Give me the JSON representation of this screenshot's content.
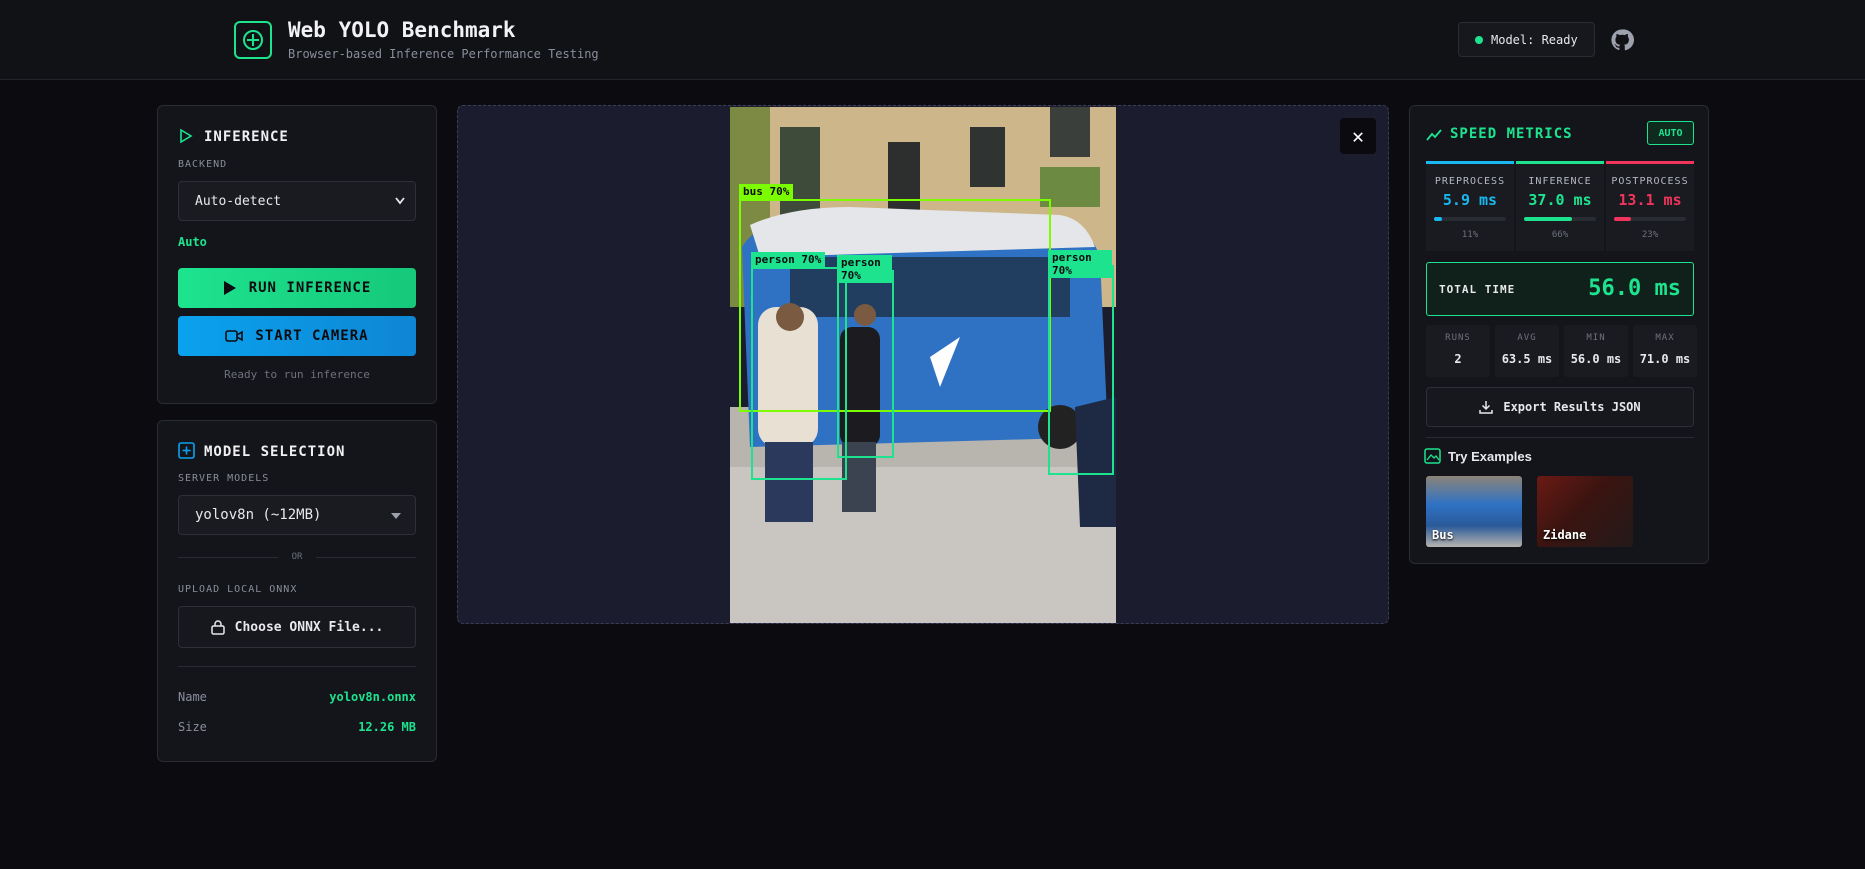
{
  "header": {
    "title": "Web YOLO Benchmark",
    "subtitle": "Browser-based Inference Performance Testing",
    "status": "Model: Ready"
  },
  "inference": {
    "title": "INFERENCE",
    "backend_label": "BACKEND",
    "backend_value": "Auto-detect",
    "backend_detected": "Auto",
    "run_label": "RUN INFERENCE",
    "camera_label": "START CAMERA",
    "status_text": "Ready to run inference"
  },
  "model": {
    "title": "MODEL SELECTION",
    "server_label": "SERVER MODELS",
    "server_value": "yolov8n (~12MB)",
    "or_text": "OR",
    "upload_label": "UPLOAD LOCAL ONNX",
    "choose_label": "Choose ONNX File...",
    "name_key": "Name",
    "name_value": "yolov8n.onnx",
    "size_key": "Size",
    "size_value": "12.26 MB"
  },
  "detections": [
    {
      "label": "bus 70%",
      "color": "#7cfc00"
    },
    {
      "label": "person 70%",
      "color": "#1de38f"
    },
    {
      "label": "person 70%",
      "color": "#1de38f"
    },
    {
      "label": "person 70%",
      "color": "#1de38f"
    }
  ],
  "metrics": {
    "title": "SPEED METRICS",
    "badge": "AUTO",
    "preprocess": {
      "name": "PREPROCESS",
      "value": "5.9 ms",
      "pct": "11%",
      "fraction": 0.11,
      "color": "#19b8f0"
    },
    "inference": {
      "name": "INFERENCE",
      "value": "37.0 ms",
      "pct": "66%",
      "fraction": 0.66,
      "color": "#1de38f"
    },
    "postprocess": {
      "name": "POSTPROCESS",
      "value": "13.1 ms",
      "pct": "23%",
      "fraction": 0.23,
      "color": "#f0345b"
    },
    "total_label": "TOTAL TIME",
    "total_value": "56.0 ms",
    "runs_k": "RUNS",
    "runs_v": "2",
    "avg_k": "AVG",
    "avg_v": "63.5 ms",
    "min_k": "MIN",
    "min_v": "56.0 ms",
    "max_k": "MAX",
    "max_v": "71.0 ms",
    "export_label": "Export Results JSON",
    "examples_title": "Try Examples",
    "examples": [
      {
        "label": "Bus"
      },
      {
        "label": "Zidane"
      }
    ]
  },
  "colors": {
    "accent": "#1de38f",
    "blue": "#0aa2ee",
    "red": "#f0345b"
  }
}
